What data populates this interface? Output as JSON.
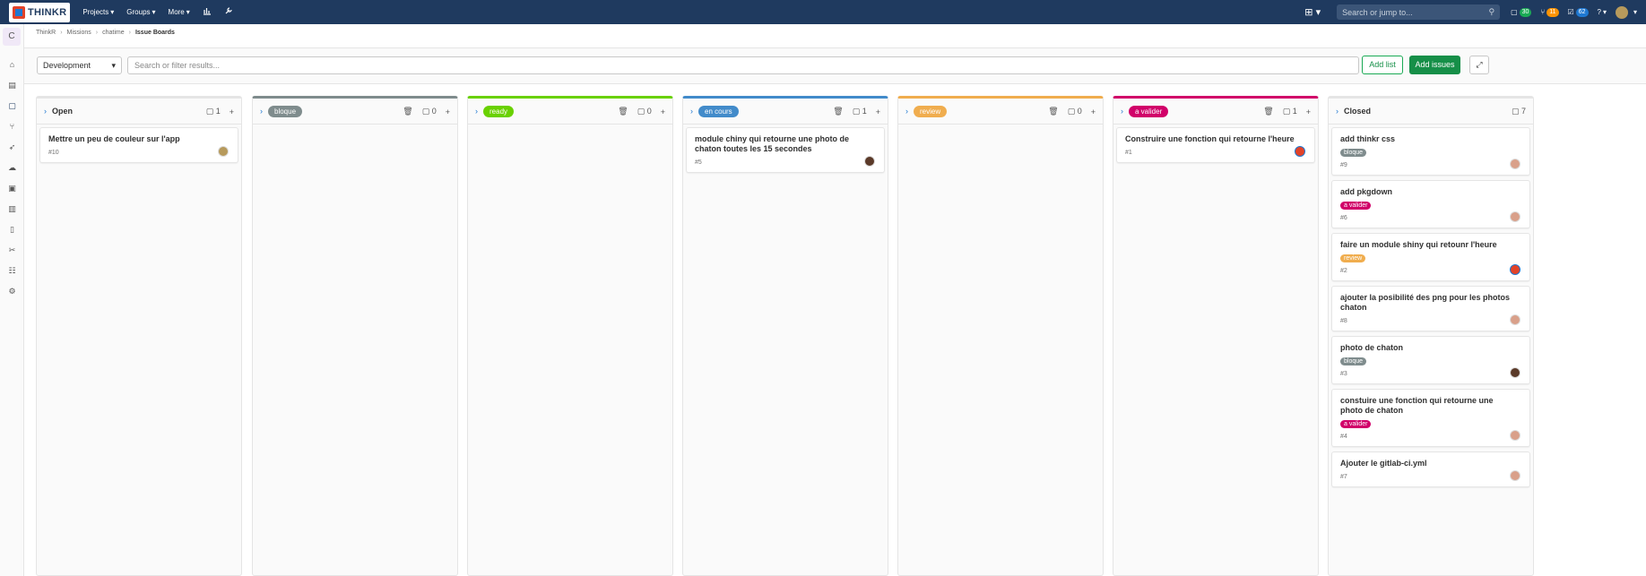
{
  "colors": {
    "topbar": "#1f3a5f",
    "bloque": "#7f8c8d",
    "ready": "#69d100",
    "en_cours": "#428bca",
    "review": "#f0ad4e",
    "a_valider": "#d10069",
    "closed": "#bfbfbf",
    "primary": "#168f48"
  },
  "topbar": {
    "logo_text": "THINKR",
    "projects": "Projects",
    "groups": "Groups",
    "more": "More",
    "search_placeholder": "Search or jump to...",
    "issues_count": "30",
    "mr_count": "11",
    "todos_count": "62"
  },
  "sidebar": {
    "project_letter": "C",
    "icons": [
      "home-icon",
      "repository-icon",
      "issues-icon",
      "merge-request-icon",
      "rocket-icon",
      "operations-icon",
      "package-icon",
      "analytics-icon",
      "wiki-icon",
      "snippets-icon",
      "members-icon",
      "settings-icon"
    ]
  },
  "breadcrumb": {
    "items": [
      "ThinkR",
      "Missions",
      "chatime"
    ],
    "current": "Issue Boards"
  },
  "filterbar": {
    "board": "Development",
    "search_placeholder": "Search or filter results...",
    "add_list": "Add list",
    "add_issues": "Add issues"
  },
  "lists": [
    {
      "title": "Open",
      "count": "1",
      "cards": [
        {
          "title": "Mettre un peu de couleur sur l'app",
          "num": "#10"
        }
      ]
    },
    {
      "label": "bloque",
      "count": "0",
      "cards": []
    },
    {
      "label": "ready",
      "count": "0",
      "cards": []
    },
    {
      "label": "en cours",
      "count": "1",
      "cards": [
        {
          "title": "module chiny qui retourne une photo de chaton toutes les 15 secondes",
          "num": "#5"
        }
      ]
    },
    {
      "label": "review",
      "count": "0",
      "cards": []
    },
    {
      "label": "a valider",
      "count": "1",
      "cards": [
        {
          "title": "Construire une fonction qui retourne l'heure",
          "num": "#1"
        }
      ]
    },
    {
      "title": "Closed",
      "count": "7",
      "cards": [
        {
          "title": "add thinkr css",
          "label": "bloque",
          "num": "#9"
        },
        {
          "title": "add pkgdown",
          "label": "a valider",
          "num": "#6"
        },
        {
          "title": "faire un module shiny qui retounr l'heure",
          "label": "review",
          "num": "#2"
        },
        {
          "title": "ajouter la posibilité des png pour les photos chaton",
          "num": "#8"
        },
        {
          "title": "photo de chaton",
          "label": "bloque",
          "num": "#3"
        },
        {
          "title": "constuire une fonction qui retourne une photo de chaton",
          "label": "a valider",
          "num": "#4"
        },
        {
          "title": "Ajouter le gitlab-ci.yml",
          "num": "#7"
        }
      ]
    }
  ]
}
